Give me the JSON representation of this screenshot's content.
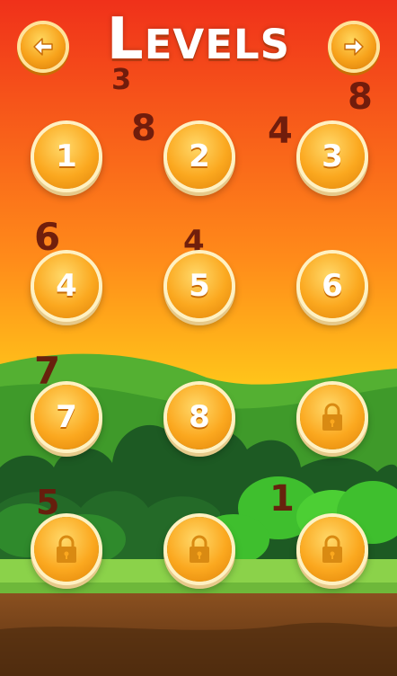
{
  "screen": {
    "title": "Levels",
    "back_icon": "arrow-left-icon",
    "next_icon": "arrow-right-icon"
  },
  "levels": [
    {
      "label": "1",
      "locked": false
    },
    {
      "label": "2",
      "locked": false
    },
    {
      "label": "3",
      "locked": false
    },
    {
      "label": "4",
      "locked": false
    },
    {
      "label": "5",
      "locked": false
    },
    {
      "label": "6",
      "locked": false
    },
    {
      "label": "7",
      "locked": false
    },
    {
      "label": "8",
      "locked": false
    },
    {
      "label": "",
      "locked": true
    },
    {
      "label": "",
      "locked": true
    },
    {
      "label": "",
      "locked": true
    },
    {
      "label": "",
      "locked": true
    }
  ],
  "falling_numbers": [
    "3",
    "8",
    "8",
    "4",
    "6",
    "4",
    "7",
    "5",
    "1"
  ],
  "colors": {
    "sky_top": "#f0311a",
    "sky_mid": "#ff9b1a",
    "sky_bottom": "#ffd21a",
    "button_orange": "#fba81f",
    "button_ring": "#fff1c2",
    "hill_green": "#3f9a2a",
    "bush_dark": "#1d5a23",
    "grass_light": "#8bd24a",
    "soil": "#7a4616"
  }
}
